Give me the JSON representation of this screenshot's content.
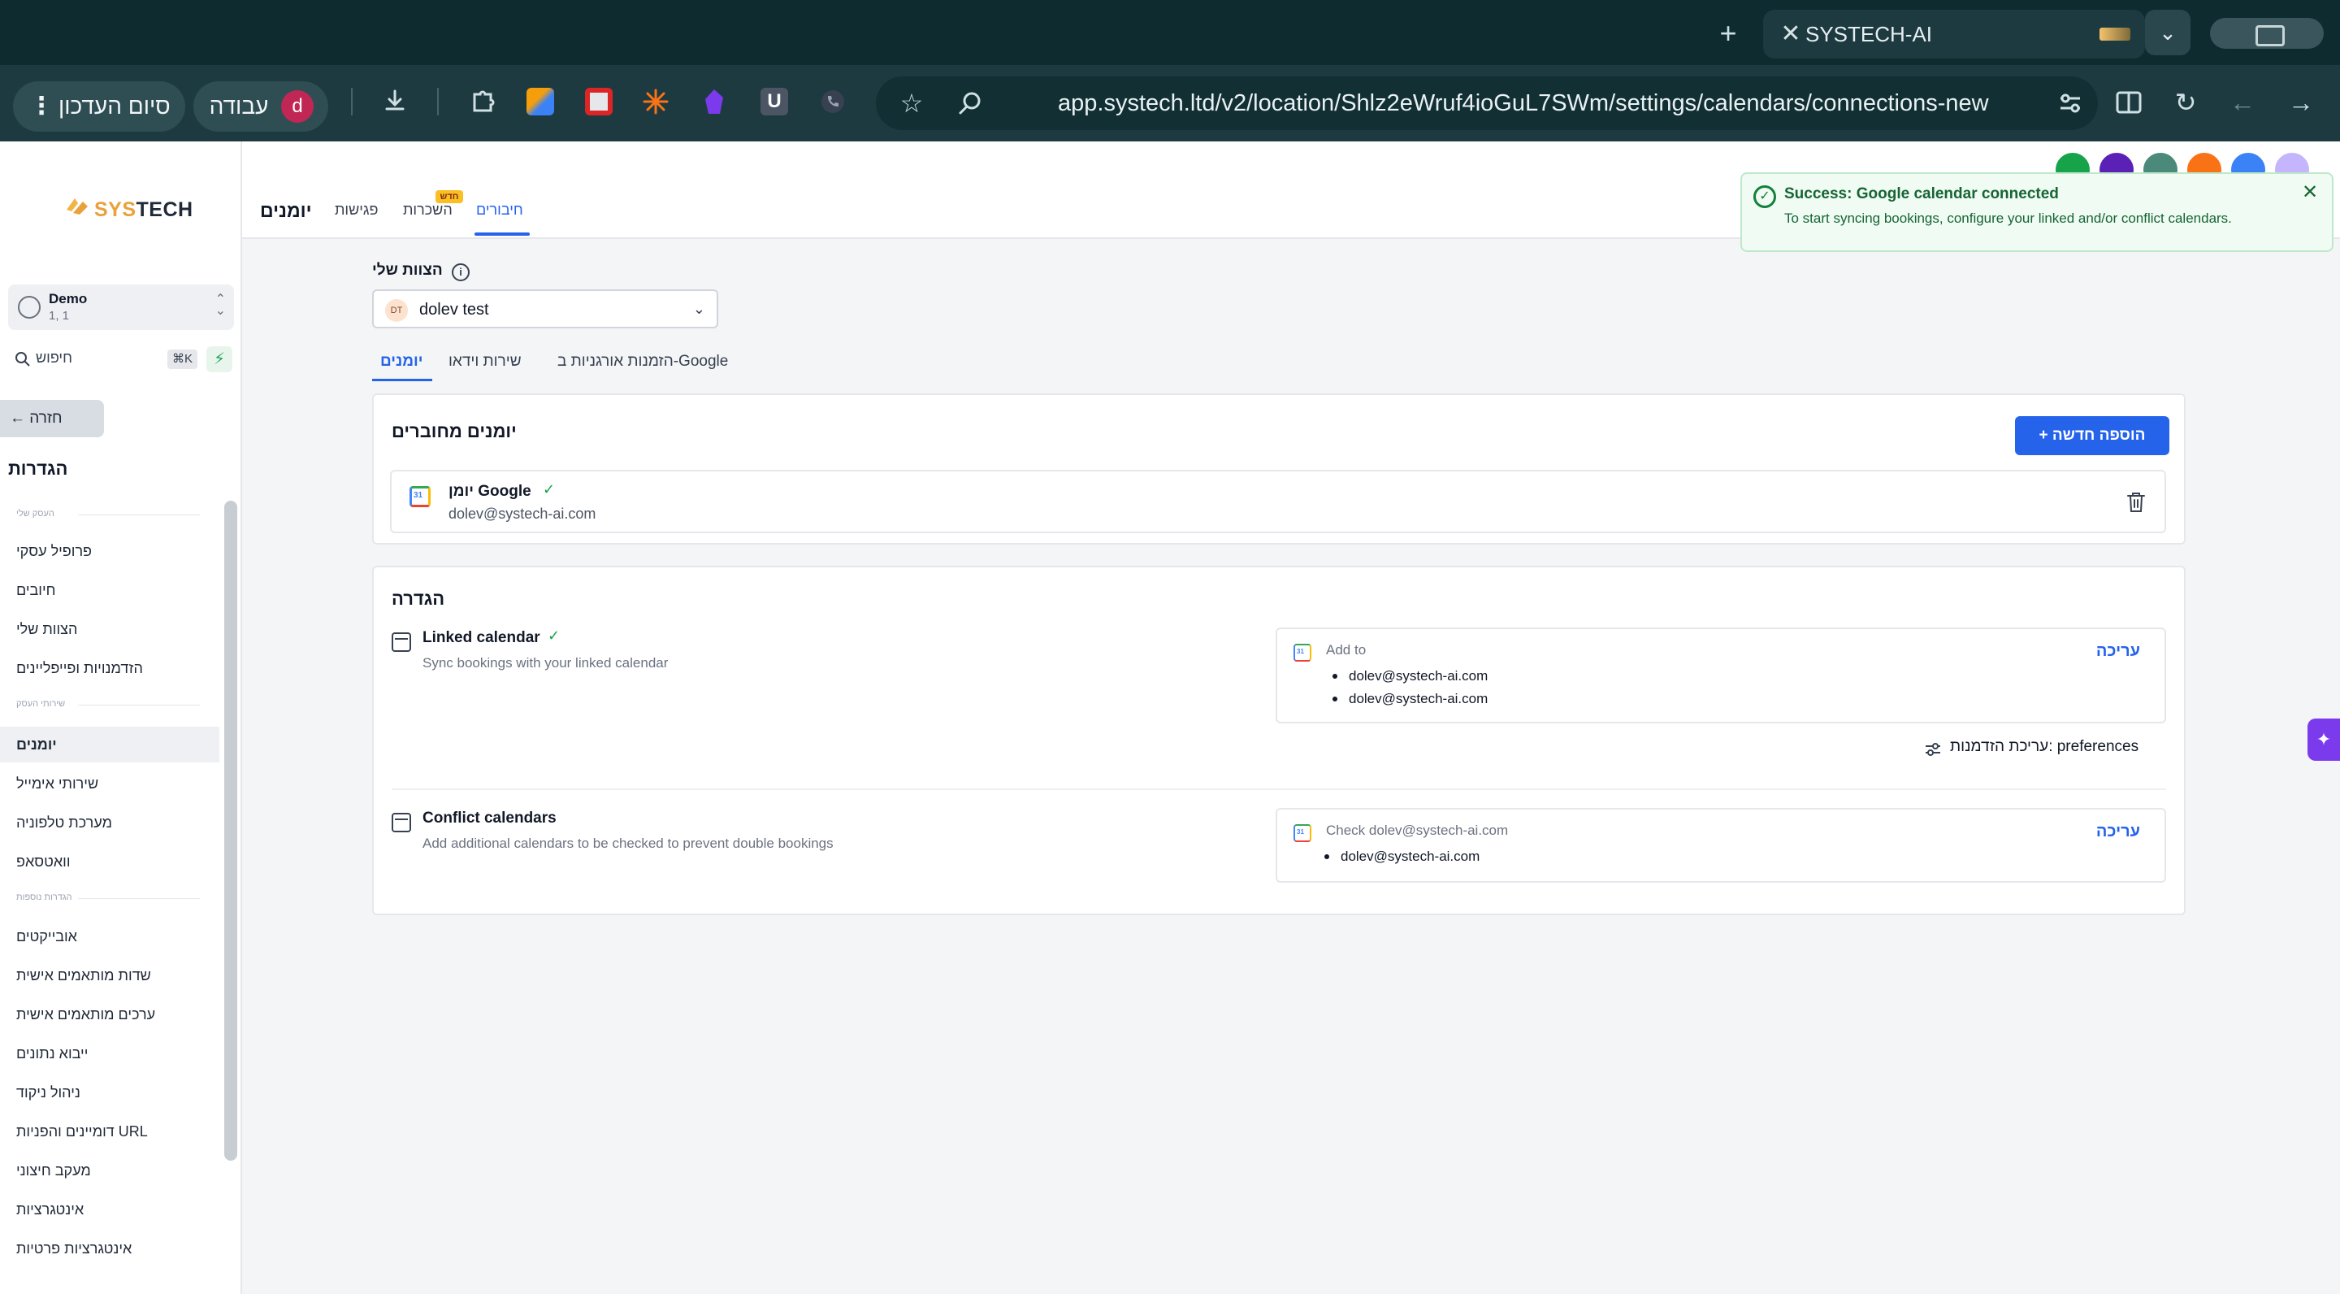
{
  "browser": {
    "tab_title": "SYSTECH-AI",
    "tab_close": "✕",
    "new_tab": "+",
    "dropdown": "⌄",
    "url": "app.systech.ltd/v2/location/Shlz2eWruf4ioGuL7SWm/settings/calendars/connections-new",
    "finish_label": "סיום העדכון",
    "menu_dots": "⋮",
    "work_label": "עבודה",
    "profile_initial": "d",
    "ext_u": "U",
    "back": "←",
    "forward": "→",
    "reload": "↻"
  },
  "sidebar": {
    "logo": "SYSTECH",
    "logo_sy": "SYS",
    "logo_tech": "TECH",
    "account_name": "Demo",
    "account_sub": "1, 1",
    "search_placeholder": "חיפוש",
    "search_shortcut": "⌘K",
    "back_label": "חזרה",
    "settings_heading": "הגדרות",
    "sections": {
      "business": "העסק שלי",
      "services": "שירותי העסק",
      "other": "הגדרות נוספות"
    },
    "items": [
      "פרופיל עסקי",
      "חיובים",
      "הצוות שלי",
      "הזדמנויות ופייפליינים",
      "יומנים",
      "שירותי אימייל",
      "מערכת טלפוניה",
      "וואטסאפ",
      "אובייקטים",
      "שדות מותאמים אישית",
      "ערכים מותאמים אישית",
      "ייבוא נתונים",
      "ניהול ניקוד",
      "דומיינים והפניות URL",
      "מעקב חיצוני",
      "אינטגרציות",
      "אינטגרציות פרטיות"
    ]
  },
  "header": {
    "title": "יומנים",
    "tabs": [
      "פגישות",
      "השכרות",
      "חיבורים"
    ],
    "new_badge": "חדש"
  },
  "toast": {
    "title": "Success: Google calendar connected",
    "message": "To start syncing bookings, configure your linked and/or conflict calendars.",
    "close": "✕"
  },
  "team": {
    "label": "הצוות שלי",
    "selected_initials": "DT",
    "selected": "dolev test"
  },
  "subtabs": [
    "יומנים",
    "שירות וידאו",
    "הזמנות אורגניות ב-Google"
  ],
  "connected": {
    "title": "יומנים מחוברים",
    "add_button": "+ הוספה חדשה",
    "calendar_name": "יומן Google",
    "calendar_email": "dolev@systech-ai.com"
  },
  "config": {
    "title": "הגדרה",
    "linked_title": "Linked calendar",
    "linked_sub": "Sync bookings with your linked calendar",
    "add_to_label": "Add to",
    "add_to_emails": [
      "dolev@systech-ai.com",
      "dolev@systech-ai.com"
    ],
    "edit_label": "עריכה",
    "preferences": "עריכת הזדמנות: preferences",
    "conflict_title": "Conflict calendars",
    "conflict_sub": "Add additional calendars to be checked to prevent double bookings",
    "check_label": "Check dolev@systech-ai.com",
    "check_emails": [
      "dolev@systech-ai.com"
    ]
  },
  "colors": {
    "primary": "#2563eb",
    "success": "#16a34a",
    "chrome": "#1d3a40"
  }
}
